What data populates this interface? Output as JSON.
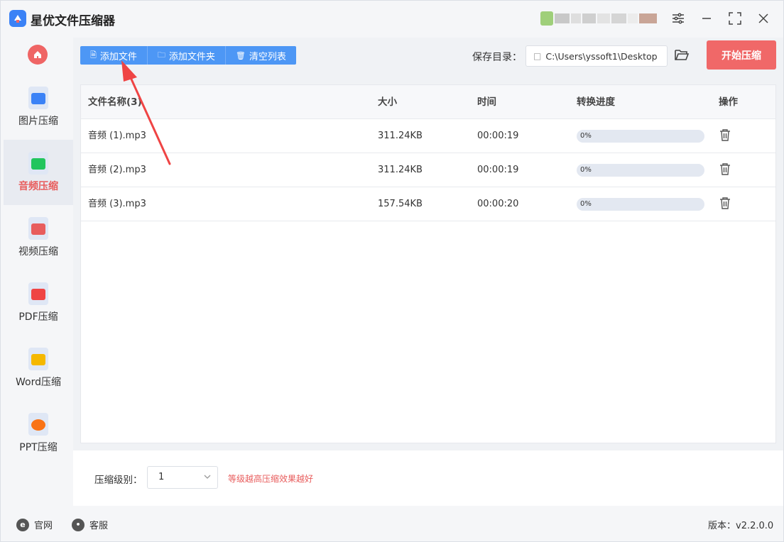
{
  "app": {
    "title": "星优文件压缩器"
  },
  "sidebar": {
    "items": [
      {
        "label": "图片压缩",
        "icon": "image-file-icon",
        "color": "#3b82f6"
      },
      {
        "label": "音频压缩",
        "icon": "audio-file-icon",
        "color": "#22c55e"
      },
      {
        "label": "视频压缩",
        "icon": "video-file-icon",
        "color": "#e85d5d"
      },
      {
        "label": "PDF压缩",
        "icon": "pdf-file-icon",
        "color": "#ef4444"
      },
      {
        "label": "Word压缩",
        "icon": "word-file-icon",
        "color": "#f5b800"
      },
      {
        "label": "PPT压缩",
        "icon": "ppt-file-icon",
        "color": "#f97316"
      }
    ],
    "active_index": 1
  },
  "toolbar": {
    "add_file": "添加文件",
    "add_folder": "添加文件夹",
    "clear_list": "清空列表",
    "save_dir_label": "保存目录：",
    "save_dir_path": "C:\\Users\\yssoft1\\Desktop",
    "start_button": "开始压缩"
  },
  "table": {
    "headers": {
      "name": "文件名称(3)",
      "size": "大小",
      "time": "时间",
      "progress": "转换进度",
      "action": "操作"
    },
    "rows": [
      {
        "name": "音频 (1).mp3",
        "size": "311.24KB",
        "time": "00:00:19",
        "progress": "0%"
      },
      {
        "name": "音频 (2).mp3",
        "size": "311.24KB",
        "time": "00:00:19",
        "progress": "0%"
      },
      {
        "name": "音频 (3).mp3",
        "size": "157.54KB",
        "time": "00:00:20",
        "progress": "0%"
      }
    ]
  },
  "settings": {
    "level_label": "压缩级别：",
    "level_value": "1",
    "level_hint": "等级越高压缩效果越好"
  },
  "footer": {
    "website": "官网",
    "support": "客服",
    "version": "版本：v2.2.0.0"
  },
  "colors": {
    "accent_blue": "#4d97f5",
    "accent_red": "#f06868"
  }
}
